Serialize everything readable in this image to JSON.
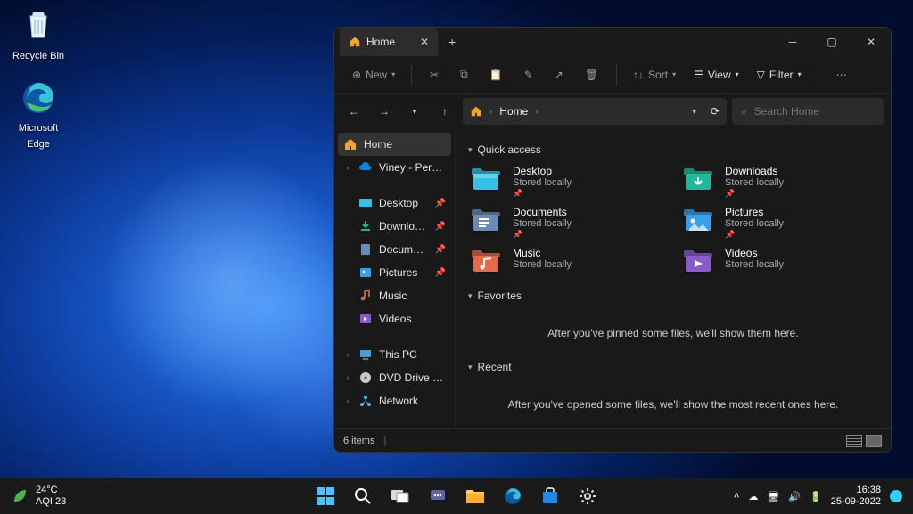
{
  "desktop": {
    "icons": [
      {
        "name": "Recycle Bin"
      },
      {
        "name": "Microsoft Edge"
      }
    ]
  },
  "explorer": {
    "tab_title": "Home",
    "toolbar": {
      "new": "New",
      "sort": "Sort",
      "view": "View",
      "filter": "Filter"
    },
    "address": {
      "crumb": "Home"
    },
    "search_placeholder": "Search Home",
    "sidebar": {
      "home": "Home",
      "onedrive": "Viney - Personal",
      "desktop": "Desktop",
      "downloads": "Downloads",
      "documents": "Documents",
      "pictures": "Pictures",
      "music": "Music",
      "videos": "Videos",
      "thispc": "This PC",
      "dvd": "DVD Drive (D:) CCC",
      "network": "Network"
    },
    "sections": {
      "quick_access": "Quick access",
      "favorites": "Favorites",
      "recent": "Recent"
    },
    "qa": [
      {
        "name": "Desktop",
        "sub": "Stored locally",
        "pinned": true,
        "color": "#37c0e6"
      },
      {
        "name": "Downloads",
        "sub": "Stored locally",
        "pinned": true,
        "color": "#1fb89a"
      },
      {
        "name": "Documents",
        "sub": "Stored locally",
        "pinned": true,
        "color": "#6a8bb5"
      },
      {
        "name": "Pictures",
        "sub": "Stored locally",
        "pinned": true,
        "color": "#3a9ee8"
      },
      {
        "name": "Music",
        "sub": "Stored locally",
        "pinned": false,
        "color": "#e46a4a"
      },
      {
        "name": "Videos",
        "sub": "Stored locally",
        "pinned": false,
        "color": "#8a5acc"
      }
    ],
    "favorites_empty": "After you've pinned some files, we'll show them here.",
    "recent_empty": "After you've opened some files, we'll show the most recent ones here.",
    "status_items": "6 items"
  },
  "taskbar": {
    "weather": {
      "temp": "24°C",
      "aqi": "AQI 23"
    },
    "clock": {
      "time": "16:38",
      "date": "25-09-2022"
    }
  }
}
